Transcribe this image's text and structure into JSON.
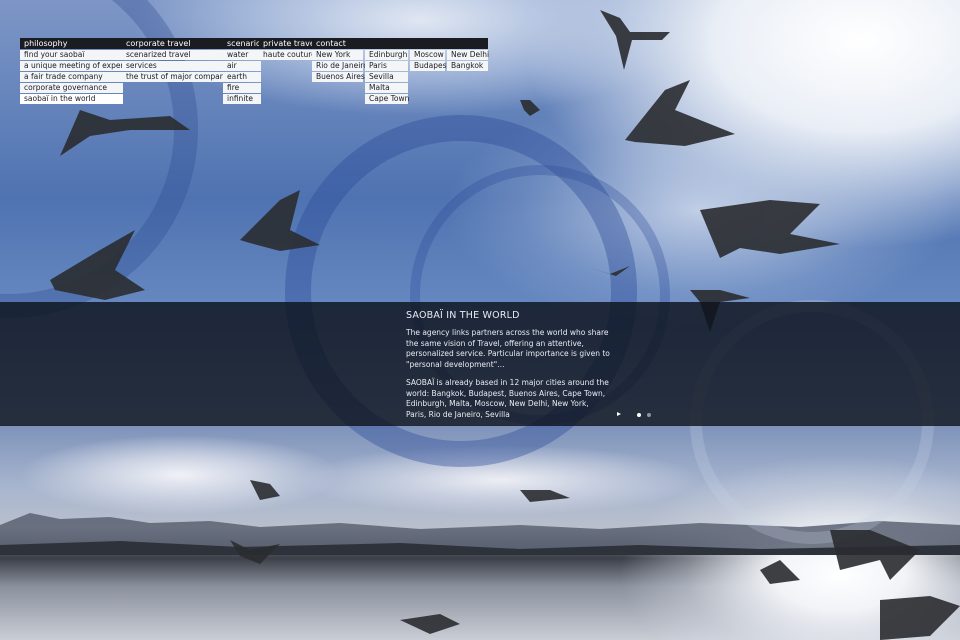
{
  "menu": {
    "columns": [
      {
        "header": "philosophy",
        "items": [
          "find your saobaï",
          "a unique meeting of expertise",
          "a fair trade company",
          "corporate governance",
          "saobaï in the world"
        ]
      },
      {
        "header": "corporate travel",
        "items": [
          "scenarized travel",
          "services",
          "the trust of major companies"
        ]
      },
      {
        "header": "scenario",
        "items": [
          "water",
          "air",
          "earth",
          "fire",
          "infinite"
        ]
      },
      {
        "header": "private travel",
        "items": [
          "haute couture"
        ]
      },
      {
        "header": "contact",
        "subcolumns": [
          [
            "New York",
            "Rio de Janeiro",
            "Buenos Aires"
          ],
          [
            "Edinburgh",
            "Paris",
            "Sevilla",
            "Malta",
            "Cape Town"
          ],
          [
            "Moscow",
            "Budapest"
          ],
          [
            "New Delhi",
            "Bangkok"
          ]
        ]
      }
    ]
  },
  "info": {
    "title": "SAOBAÏ IN THE WORLD",
    "paragraph1": "The agency links partners across the world who share the same vision of Travel, offering an attentive, personalized service. Particular importance is given to \"personal development\"…",
    "paragraph2": "SAOBAÏ is already based in 12 major cities around the world: Bangkok, Budapest, Buenos Aires, Cape Town, Edinburgh, Malta, Moscow, New Delhi, New York, Paris, Rio de Janeiro, Sevilla"
  },
  "pager": {
    "current": 1,
    "total": 2
  },
  "colors": {
    "menu_header": "#1a1c22",
    "menu_item": "#f4f5f7",
    "band": "#0e121c"
  }
}
